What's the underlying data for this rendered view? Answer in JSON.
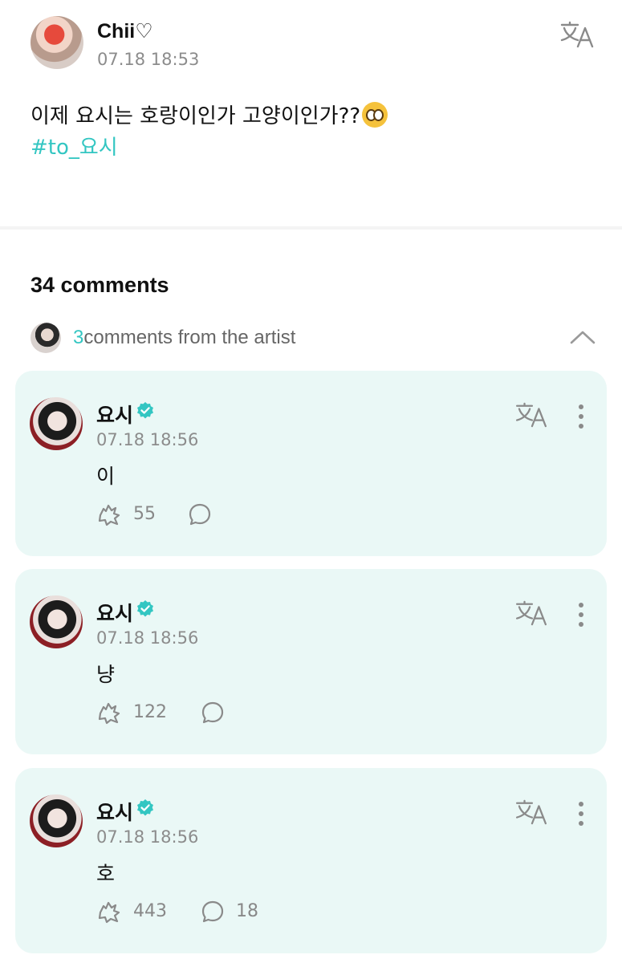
{
  "post": {
    "author": "Chii♡",
    "time": "07.18 18:53",
    "text": "이제 요시는 호랑이인가 고양이인가??",
    "emoji_icon": "flushed-face-emoji",
    "hashtag": "#to_요시"
  },
  "comments_section": {
    "count_label": "34 comments",
    "artist_count": "3",
    "artist_label": "comments from the artist"
  },
  "artist_comments": [
    {
      "name": "요시",
      "time": "07.18 18:56",
      "text": "이",
      "likes": "55",
      "replies": ""
    },
    {
      "name": "요시",
      "time": "07.18 18:56",
      "text": "냥",
      "likes": "122",
      "replies": ""
    },
    {
      "name": "요시",
      "time": "07.18 18:56",
      "text": "호",
      "likes": "443",
      "replies": "18"
    }
  ],
  "colors": {
    "accent": "#33c6c2",
    "card_background": "#eaf8f6",
    "muted_text": "#8c8c8c"
  }
}
